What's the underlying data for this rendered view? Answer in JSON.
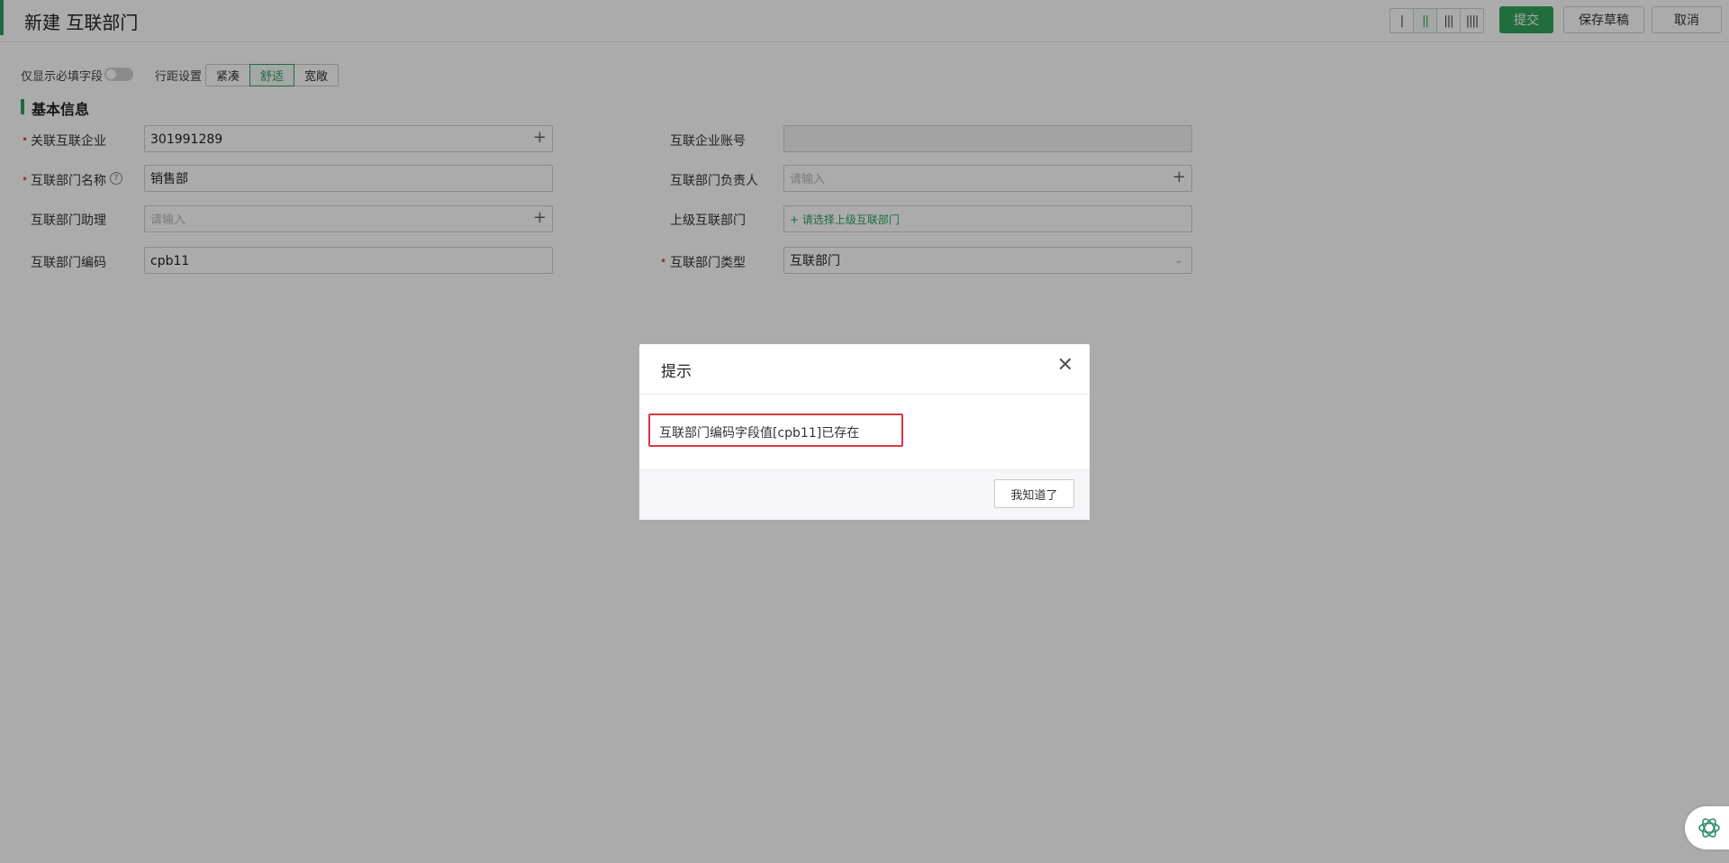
{
  "header": {
    "title": "新建 互联部门",
    "layout_options": [
      "|",
      "||",
      "|||",
      "||||"
    ],
    "submit_label": "提交",
    "save_draft_label": "保存草稿",
    "cancel_label": "取消"
  },
  "toolbar": {
    "required_only_label": "仅显示必填字段",
    "required_only_on": false,
    "row_spacing_label": "行距设置",
    "row_spacing_options": [
      "紧凑",
      "舒适",
      "宽敞"
    ],
    "row_spacing_selected": "舒适"
  },
  "section": {
    "title": "基本信息"
  },
  "form": {
    "linked_enterprise": {
      "label": "关联互联企业",
      "required": true,
      "value": "301991289"
    },
    "dept_name": {
      "label": "互联部门名称",
      "required": true,
      "value": "销售部"
    },
    "dept_assistant": {
      "label": "互联部门助理",
      "required": false,
      "placeholder": "请输入"
    },
    "dept_code": {
      "label": "互联部门编码",
      "required": false,
      "value": "cpb11"
    },
    "enterprise_account": {
      "label": "互联企业账号",
      "required": false,
      "value": ""
    },
    "dept_owner": {
      "label": "互联部门负责人",
      "required": false,
      "placeholder": "请输入"
    },
    "parent_dept": {
      "label": "上级互联部门",
      "required": false,
      "link_text": "+ 请选择上级互联部门"
    },
    "dept_type": {
      "label": "互联部门类型",
      "required": true,
      "value": "互联部门"
    }
  },
  "dialog": {
    "title": "提示",
    "message": "互联部门编码字段值[cpb11]已存在",
    "confirm_label": "我知道了"
  },
  "colors": {
    "accent": "#30a060",
    "primary_button": "#31a55b",
    "error_border": "#d9363e",
    "required_mark": "#e5484d"
  }
}
